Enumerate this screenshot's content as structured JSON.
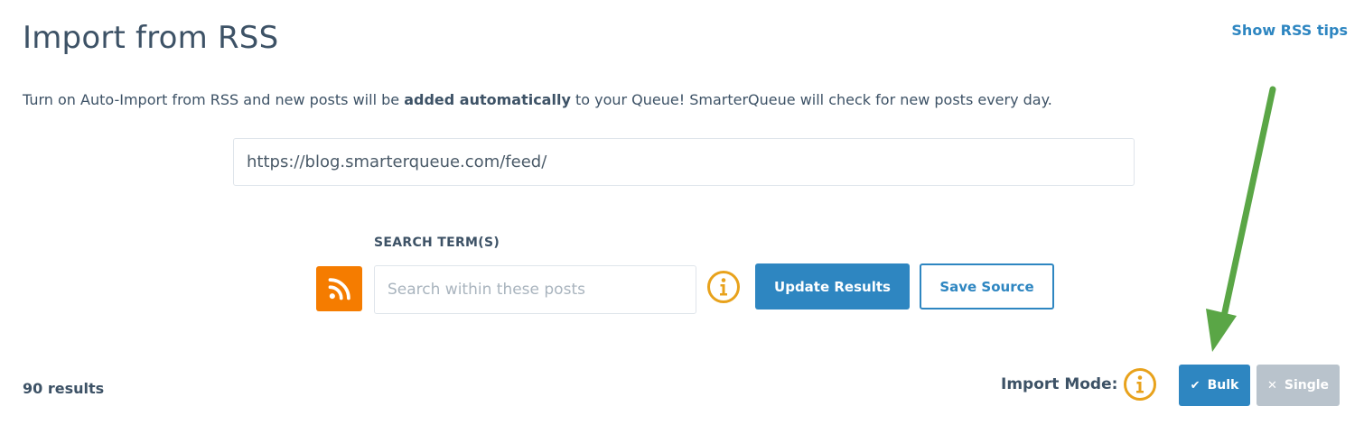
{
  "header": {
    "title": "Import from RSS",
    "rss_tips_link": "Show RSS tips"
  },
  "description": {
    "before": "Turn on Auto-Import from RSS and new posts will be ",
    "bold": "added automatically",
    "after": " to your Queue! SmarterQueue will check for new posts every day."
  },
  "feed": {
    "url_value": "https://blog.smarterqueue.com/feed/"
  },
  "search": {
    "label": "SEARCH TERM(S)",
    "placeholder": "Search within these posts",
    "value": ""
  },
  "actions": {
    "update_label": "Update Results",
    "save_label": "Save Source"
  },
  "footer": {
    "results_text": "90 results",
    "import_mode_label": "Import Mode:",
    "bulk_label": "Bulk",
    "single_label": "Single",
    "selected_mode": "Bulk"
  },
  "icons": {
    "rss": "rss-icon",
    "info": "info-icon",
    "check": "check-icon",
    "close": "close-icon",
    "annotation_arrow": "arrow-icon"
  },
  "colors": {
    "accent": "#2e86c1",
    "rss_orange": "#f57c00",
    "info_yellow": "#e8a21c",
    "disabled_gray": "#b9c3cc",
    "arrow_green": "#5aa646",
    "text": "#3d5266"
  }
}
